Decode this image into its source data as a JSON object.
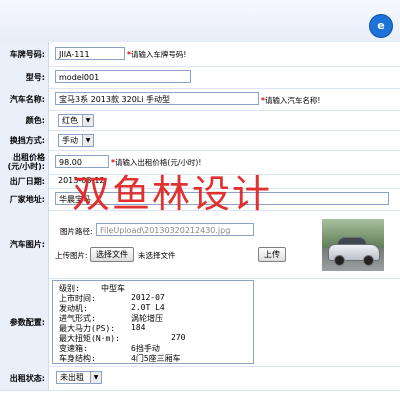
{
  "header": {
    "logo_text": "e"
  },
  "form": {
    "plate": {
      "label": "车牌号码:",
      "value": "JIIA-111",
      "required": "*",
      "hint": "请输入车牌号码!"
    },
    "model": {
      "label": "型号:",
      "value": "model001"
    },
    "name": {
      "label": "汽车名称:",
      "value": "宝马3系 2013款 320Li 手动型",
      "required": "*",
      "hint": "请输入汽车名称!"
    },
    "color": {
      "label": "颜色:",
      "value": "红色"
    },
    "gear": {
      "label": "换挡方式:",
      "value": "手动"
    },
    "price": {
      "label": "出租价格(元/小时):",
      "value": "98.00",
      "required": "*",
      "hint": "请输入出租价格(元/小时)!"
    },
    "date": {
      "label": "出厂日期:",
      "value": "2013-03-12"
    },
    "maker": {
      "label": "厂家地址:",
      "value": "华晨宝马"
    },
    "photo": {
      "label": "汽车图片:",
      "path_label": "图片路径:",
      "path_value": "FileUpload\\20130320212430.jpg",
      "upload_label": "上传图片:",
      "choose_button": "选择文件",
      "no_file": "未选择文件",
      "upload_button": "上传"
    },
    "specs": {
      "label": "参数配置:",
      "items": [
        {
          "key": "级别:",
          "value": "中型车"
        },
        {
          "key": "上市时间:",
          "value": "2012-07"
        },
        {
          "key": "发动机:",
          "value": "2.0T L4"
        },
        {
          "key": "进气形式:",
          "value": "涡轮增压"
        },
        {
          "key": "最大马力(PS):",
          "value": "184"
        },
        {
          "key": "最大扭矩(N·m):",
          "value": "270"
        },
        {
          "key": "变速箱:",
          "value": "6挡手动"
        },
        {
          "key": "车身结构:",
          "value": "4门5座三厢车"
        }
      ]
    },
    "status": {
      "label": "出租状态:",
      "value": "未出租"
    }
  },
  "watermark": "双鱼林设计"
}
